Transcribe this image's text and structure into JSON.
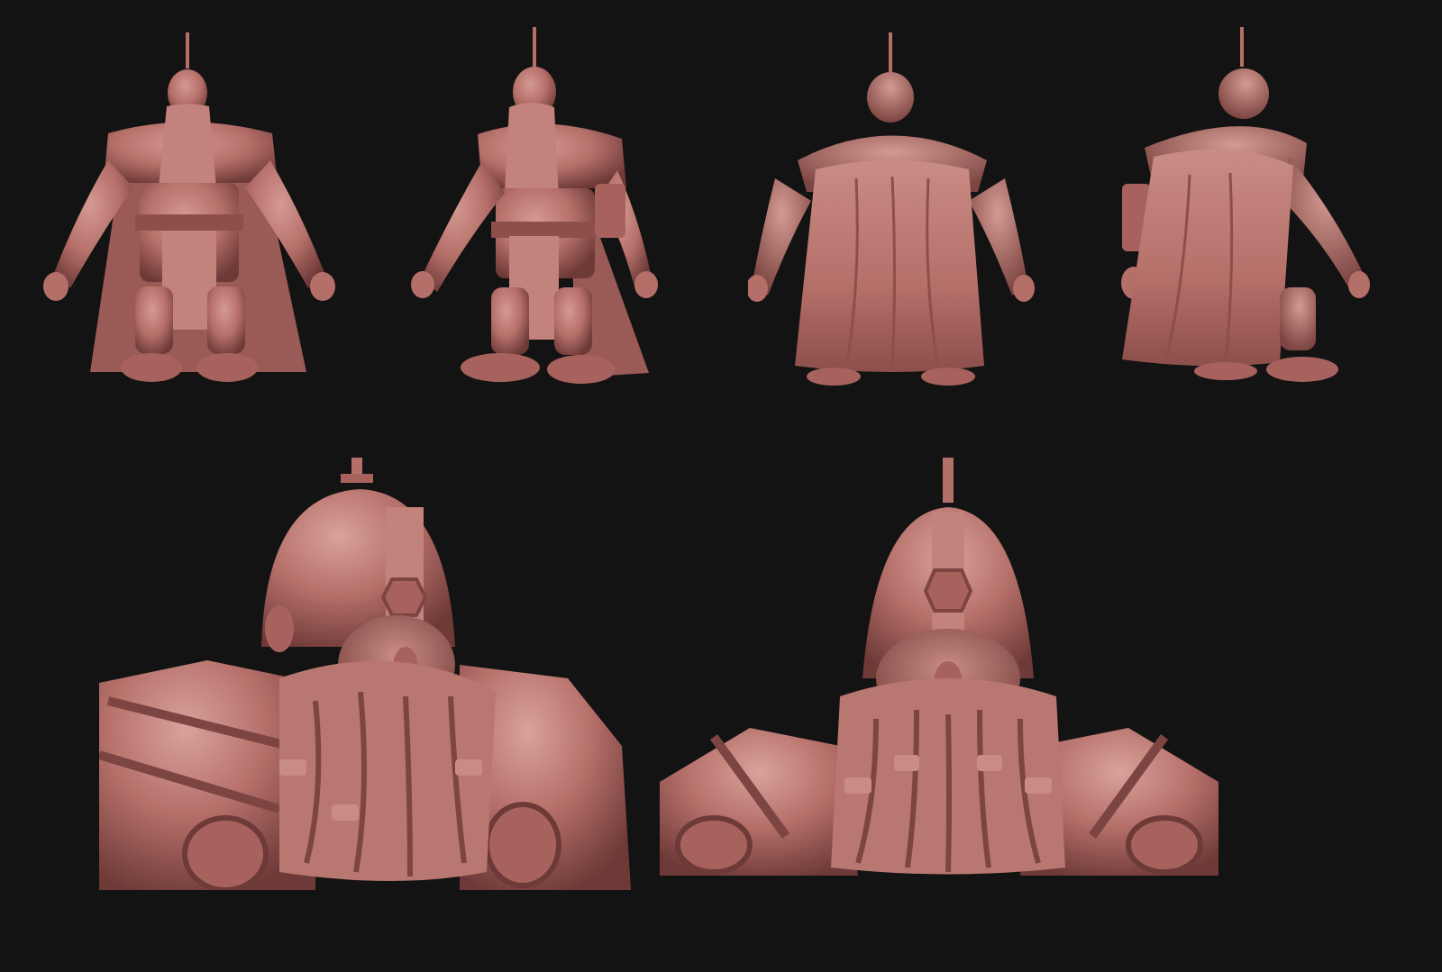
{
  "sheet": {
    "background": "#141313",
    "clay_base": "#b56f69",
    "clay_light": "#d49a92",
    "clay_shadow": "#6e3a37",
    "clay_deep": "#4a2624"
  },
  "turnaround": [
    {
      "view": "front"
    },
    {
      "view": "three-quarter-front"
    },
    {
      "view": "back"
    },
    {
      "view": "three-quarter-back"
    }
  ],
  "closeups": [
    {
      "view": "head-three-quarter"
    },
    {
      "view": "head-front"
    }
  ]
}
